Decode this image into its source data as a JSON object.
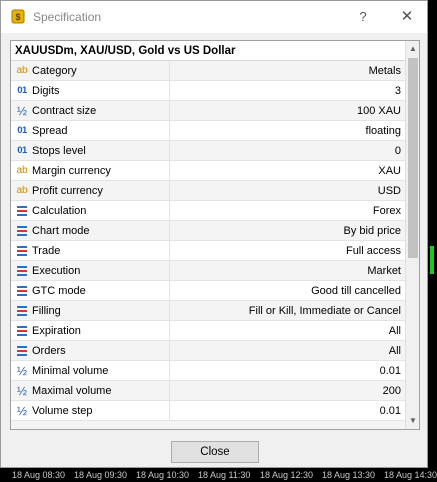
{
  "window": {
    "title": "Specification",
    "help_label": "?",
    "close_glyph": "✕",
    "icon": "app-coin-icon"
  },
  "panel": {
    "header": "XAUUSDm, XAU/USD, Gold vs US Dollar",
    "rows": [
      {
        "icon": "ab",
        "label": "Category",
        "value": "Metals"
      },
      {
        "icon": "01",
        "label": "Digits",
        "value": "3"
      },
      {
        "icon": "1/2",
        "label": "Contract size",
        "value": "100 XAU"
      },
      {
        "icon": "01",
        "label": "Spread",
        "value": "floating"
      },
      {
        "icon": "01",
        "label": "Stops level",
        "value": "0"
      },
      {
        "icon": "ab",
        "label": "Margin currency",
        "value": "XAU"
      },
      {
        "icon": "ab",
        "label": "Profit currency",
        "value": "USD"
      },
      {
        "icon": "list",
        "label": "Calculation",
        "value": "Forex"
      },
      {
        "icon": "list",
        "label": "Chart mode",
        "value": "By bid price"
      },
      {
        "icon": "list",
        "label": "Trade",
        "value": "Full access"
      },
      {
        "icon": "list",
        "label": "Execution",
        "value": "Market"
      },
      {
        "icon": "list",
        "label": "GTC mode",
        "value": "Good till cancelled"
      },
      {
        "icon": "list",
        "label": "Filling",
        "value": "Fill or Kill, Immediate or Cancel"
      },
      {
        "icon": "list",
        "label": "Expiration",
        "value": "All"
      },
      {
        "icon": "list",
        "label": "Orders",
        "value": "All"
      },
      {
        "icon": "1/2",
        "label": "Minimal volume",
        "value": "0.01"
      },
      {
        "icon": "1/2",
        "label": "Maximal volume",
        "value": "200"
      },
      {
        "icon": "1/2",
        "label": "Volume step",
        "value": "0.01"
      }
    ]
  },
  "buttons": {
    "close": "Close"
  },
  "backdrop": {
    "time_axis": [
      "18 Aug 08:30",
      "18 Aug 09:30",
      "18 Aug 10:30",
      "18 Aug 11:30",
      "18 Aug 12:30",
      "18 Aug 13:30",
      "18 Aug 14:30"
    ]
  },
  "colors": {
    "icon_blue": "#1f5fb8",
    "icon_gold": "#c98a00",
    "coin_gold": "#e8b400"
  }
}
